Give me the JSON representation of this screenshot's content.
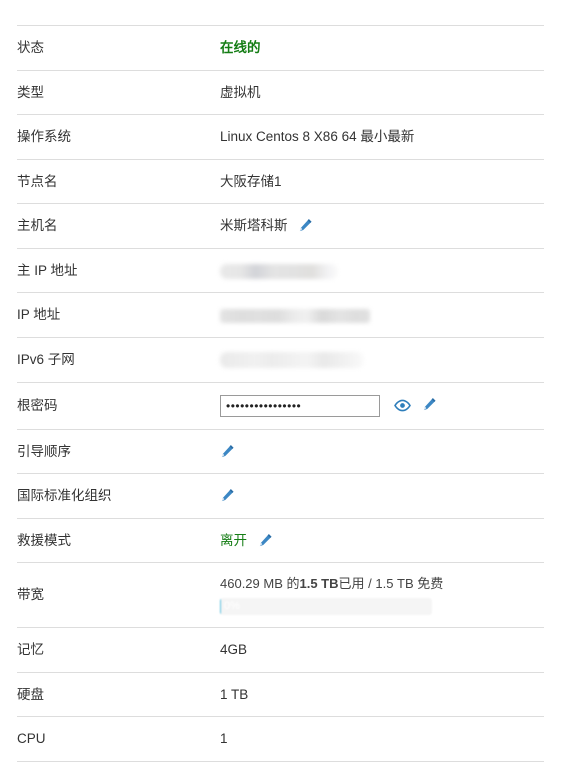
{
  "table": {
    "rows": [
      {
        "id": "status",
        "label": "状态",
        "value": "在线的",
        "kind": "green-bold"
      },
      {
        "id": "type",
        "label": "类型",
        "value": "虚拟机",
        "kind": "plain"
      },
      {
        "id": "os",
        "label": "操作系统",
        "value": "Linux Centos 8 X86 64 最小最新",
        "kind": "plain"
      },
      {
        "id": "node-name",
        "label": "节点名",
        "value": "大阪存储1",
        "kind": "plain"
      },
      {
        "id": "hostname",
        "label": "主机名",
        "value": "米斯塔科斯",
        "kind": "plain-edit",
        "edit_icon": "pencil-icon"
      },
      {
        "id": "main-ip",
        "label": "主 IP 地址",
        "value": "",
        "kind": "redacted-a"
      },
      {
        "id": "ip-address",
        "label": "IP 地址",
        "value": "",
        "kind": "redacted-b"
      },
      {
        "id": "ipv6-subnet",
        "label": "IPv6 子网",
        "value": "",
        "kind": "redacted-c"
      },
      {
        "id": "root-password",
        "label": "根密码",
        "value": "••••••••••••••••",
        "kind": "password",
        "reveal_icon": "eye-icon",
        "edit_icon": "pencil-icon"
      },
      {
        "id": "boot-order",
        "label": "引导顺序",
        "value": "",
        "kind": "edit-only",
        "edit_icon": "pencil-icon"
      },
      {
        "id": "iso",
        "label": "国际标准化组织",
        "value": "",
        "kind": "edit-only",
        "edit_icon": "pencil-icon"
      },
      {
        "id": "rescue-mode",
        "label": "救援模式",
        "value": "离开",
        "kind": "green-edit",
        "edit_icon": "pencil-icon"
      },
      {
        "id": "bandwidth",
        "label": "带宽",
        "value": "",
        "kind": "bandwidth"
      },
      {
        "id": "memory",
        "label": "记忆",
        "value": "4GB",
        "kind": "bold"
      },
      {
        "id": "disk",
        "label": "硬盘",
        "value": "1 TB",
        "kind": "bold"
      },
      {
        "id": "cpu",
        "label": "CPU",
        "value": "1",
        "kind": "bold"
      }
    ]
  },
  "bandwidth": {
    "used_prefix": "460.29 MB 的",
    "total_bold": "1.5 TB",
    "used_suffix": "已用 / 1.5 TB 免费",
    "percent_label": "0%",
    "percent_value": 0
  },
  "colors": {
    "online_green": "#157d15",
    "icon_blue": "#2e7ebb",
    "row_border": "#dddddd",
    "text": "#333333",
    "progress_track": "#f5f5f5"
  }
}
